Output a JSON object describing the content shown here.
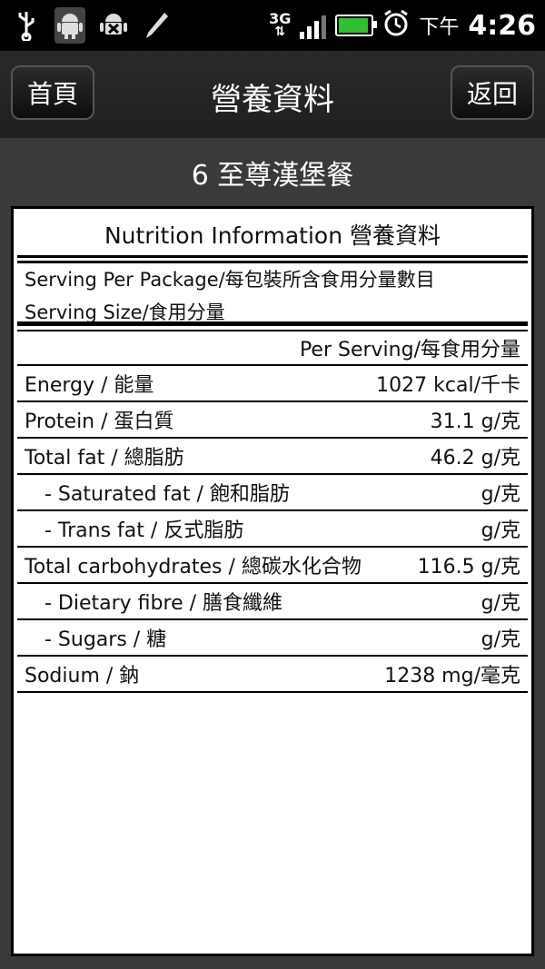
{
  "status_bar": {
    "icons_left": [
      "usb-icon",
      "android-debug-icon",
      "android-alert-icon",
      "pen-icon"
    ],
    "network": "3G",
    "ampm": "下午",
    "time": "4:26",
    "battery_color": "#2fc02f"
  },
  "title_bar": {
    "home_label": "首頁",
    "title": "營養資料",
    "back_label": "返回"
  },
  "meal_title": "6 至尊漢堡餐",
  "nutrition": {
    "header": "Nutrition Information 營養資料",
    "serving_per_package": "Serving Per Package/每包裝所含食用分量數目",
    "serving_size": "Serving Size/食用分量",
    "per_serving": "Per Serving/每食用分量",
    "rows": [
      {
        "label": "Energy / 能量",
        "value": "1027 kcal/千卡"
      },
      {
        "label": "Protein / 蛋白質",
        "value": "31.1 g/克"
      },
      {
        "label": "Total fat / 總脂肪",
        "value": "46.2 g/克"
      },
      {
        "label": "- Saturated fat / 飽和脂肪",
        "value": "g/克"
      },
      {
        "label": "- Trans fat / 反式脂肪",
        "value": "g/克"
      },
      {
        "label": "Total carbohydrates / 總碳水化合物",
        "value": "116.5 g/克"
      },
      {
        "label": "- Dietary fibre / 膳食纖維",
        "value": "g/克"
      },
      {
        "label": "- Sugars / 糖",
        "value": "g/克"
      },
      {
        "label": "Sodium / 鈉",
        "value": "1238 mg/毫克"
      }
    ]
  }
}
